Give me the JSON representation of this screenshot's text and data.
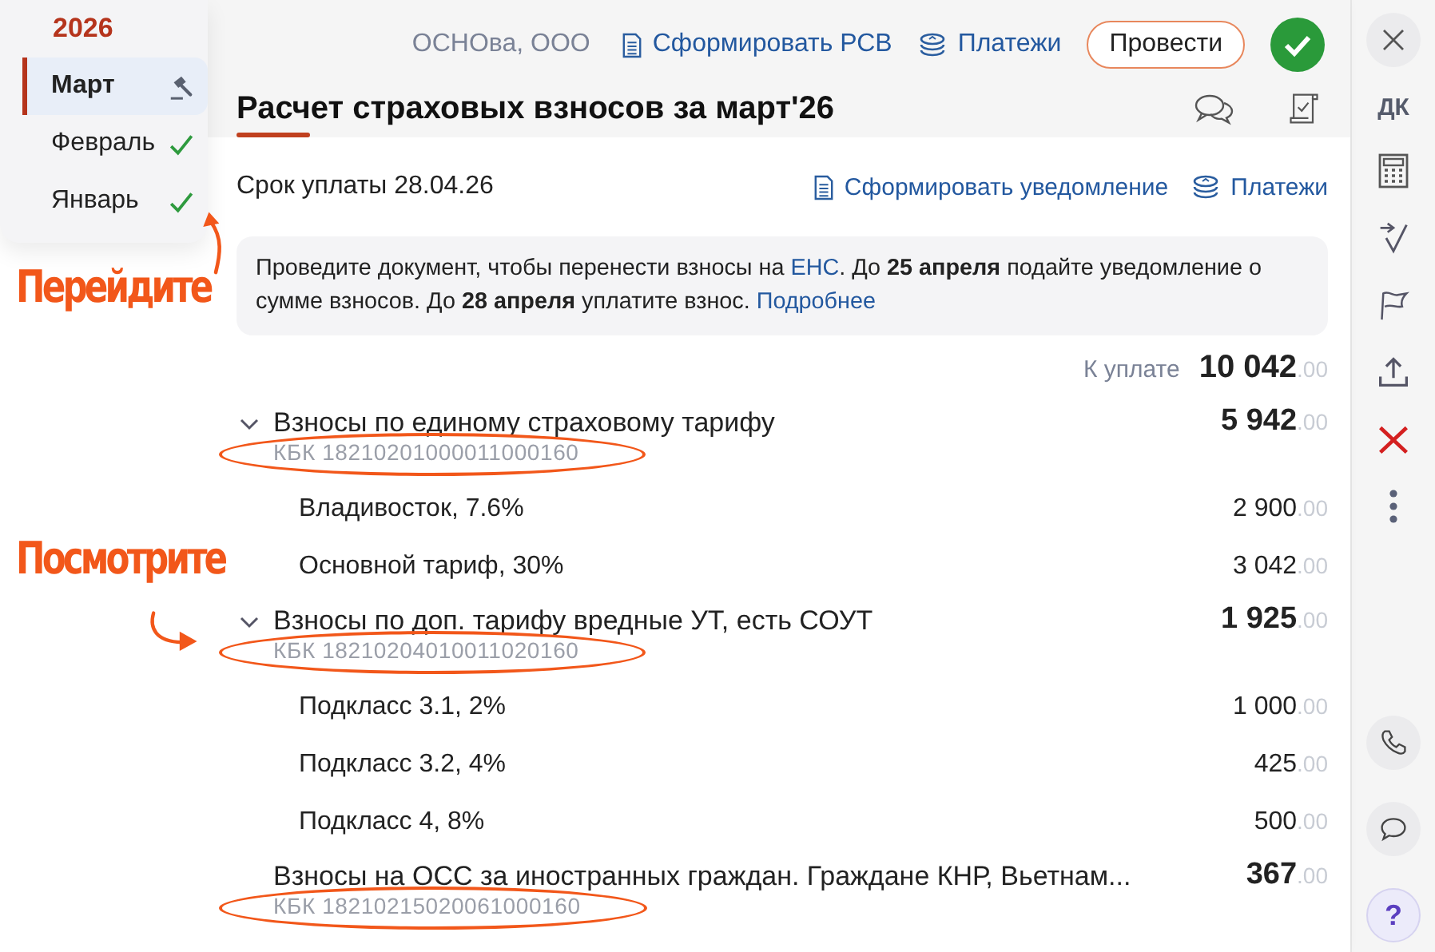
{
  "month_menu": {
    "year": "2026",
    "items": [
      {
        "label": "Март",
        "kind": "draft",
        "selected": true
      },
      {
        "label": "Февраль",
        "kind": "posted",
        "selected": false
      },
      {
        "label": "Январь",
        "kind": "posted",
        "selected": false
      }
    ]
  },
  "annotations": [
    {
      "text": "Перейдите"
    },
    {
      "text": "Посмотрите"
    }
  ],
  "header": {
    "company": "ОСНОва, ООО",
    "actions": [
      {
        "label": "Сформировать РСВ",
        "kind": "document"
      },
      {
        "label": "Платежи",
        "kind": "coins"
      }
    ],
    "post_button": "Провести",
    "title": "Расчет страховых взносов за март'26"
  },
  "due_date": "Срок уплаты 28.04.26",
  "due_actions": [
    {
      "label": "Сформировать уведомление",
      "kind": "document"
    },
    {
      "label": "Платежи",
      "kind": "coins"
    }
  ],
  "notice": [
    {
      "kind": "text",
      "text": "Проведите документ, чтобы перенести  взносы на "
    },
    {
      "kind": "link",
      "text": "ЕНС"
    },
    {
      "kind": "text",
      "text": ". До **25 апреля** подайте уведомление о сумме взносов. До **28 апреля** уплатите взнос. "
    },
    {
      "kind": "link",
      "text": "Подробнее"
    }
  ],
  "total": {
    "label": "К уплате",
    "amount": "10 042",
    "cents": ".00"
  },
  "groups": [
    {
      "kind": "expandable",
      "expanded": true,
      "title": "Взносы по единому страховому тарифу",
      "kbk": "КБК 18210201000011000160",
      "amount": "5 942",
      "cents": ".00",
      "children": [
        {
          "label": "Владивосток, 7.6%",
          "amount": "2 900",
          "cents": ".00"
        },
        {
          "label": "Основной тариф, 30%",
          "amount": "3 042",
          "cents": ".00"
        }
      ]
    },
    {
      "kind": "expandable",
      "expanded": true,
      "title": "Взносы по доп. тарифу вредные УТ, есть СОУТ",
      "kbk": "КБК 18210204010011020160",
      "amount": "1 925",
      "cents": ".00",
      "children": [
        {
          "label": "Подкласс 3.1, 2%",
          "amount": "1 000",
          "cents": ".00"
        },
        {
          "label": "Подкласс 3.2, 4%",
          "amount": "425",
          "cents": ".00"
        },
        {
          "label": "Подкласс 4, 8%",
          "amount": "500",
          "cents": ".00"
        }
      ]
    },
    {
      "kind": "plain",
      "title": "Взносы на ОСС за иностранных граждан. Граждане КНР, Вьетнам...",
      "kbk": "КБК 18210215020061000160",
      "amount": "367",
      "cents": ".00"
    }
  ],
  "sidebar": {
    "dk": "ДК",
    "help": "?"
  }
}
